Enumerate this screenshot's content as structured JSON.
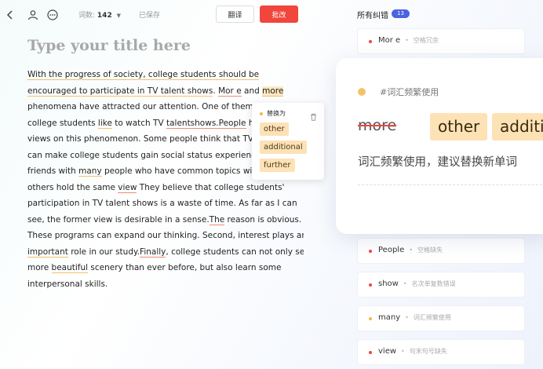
{
  "topbar": {
    "word_count_label": "词数:",
    "word_count_value": "142",
    "saved_status": "已保存",
    "translate_button": "翻译",
    "review_button": "批改"
  },
  "document": {
    "title_placeholder": "Type your title here",
    "lines": [
      [
        {
          "t": "With the progress of society, college students should be",
          "s": "y"
        }
      ],
      [
        {
          "t": "encouraged to participate in TV talent shows",
          "s": "y"
        },
        {
          "t": ". ",
          "s": ""
        },
        {
          "t": "Mor e",
          "s": "r"
        },
        {
          "t": " and ",
          "s": ""
        },
        {
          "t": "more",
          "s": "hl"
        }
      ],
      [
        {
          "t": "phenomena have attracted our attention. One of them is",
          "s": ""
        }
      ],
      [
        {
          "t": "college students ",
          "s": ""
        },
        {
          "t": "like",
          "s": "y"
        },
        {
          "t": " to watch TV ",
          "s": ""
        },
        {
          "t": "talentshows.People",
          "s": "r"
        },
        {
          "t": " hold different",
          "s": ""
        }
      ],
      [
        {
          "t": "views on this phenomenon. Some people think that TV talent shows",
          "s": ""
        }
      ],
      [
        {
          "t": "can make college students gain social status experience and make",
          "s": ""
        }
      ],
      [
        {
          "t": "friends with ",
          "s": ""
        },
        {
          "t": "many",
          "s": "y"
        },
        {
          "t": " people who have common topics with them. But",
          "s": ""
        }
      ],
      [
        {
          "t": "others hold the same ",
          "s": ""
        },
        {
          "t": "view",
          "s": "r"
        },
        {
          "t": " They believe that college students'",
          "s": ""
        }
      ],
      [
        {
          "t": "participation in TV talent shows is a waste of time. As far as I can",
          "s": ""
        }
      ],
      [
        {
          "t": "see, the former view is desirable in a sense.",
          "s": ""
        },
        {
          "t": "The",
          "s": "r"
        },
        {
          "t": " reason is obvious.",
          "s": ""
        }
      ],
      [
        {
          "t": "These programs can expand our thinking. Second, interest plays an",
          "s": ""
        }
      ],
      [
        {
          "t": "important",
          "s": "y"
        },
        {
          "t": " role in our study.",
          "s": ""
        },
        {
          "t": "Finally",
          "s": "r"
        },
        {
          "t": ", college students can not only see",
          "s": ""
        }
      ],
      [
        {
          "t": "more ",
          "s": ""
        },
        {
          "t": "beautiful",
          "s": "y"
        },
        {
          "t": " scenery than ever before, but also learn some",
          "s": ""
        }
      ],
      [
        {
          "t": "interpersonal skills.",
          "s": ""
        }
      ]
    ]
  },
  "popup": {
    "header": "替换为",
    "options": [
      "other",
      "additional",
      "further"
    ]
  },
  "panel": {
    "title": "所有纠错",
    "count": "13",
    "issues": [
      {
        "word": "Mor e",
        "desc": "空格冗余",
        "color": "#f0463c"
      },
      {
        "word": "People",
        "desc": "空格缺失",
        "color": "#f0463c"
      },
      {
        "word": "show",
        "desc": "名次单复数错误",
        "color": "#f0463c"
      },
      {
        "word": "many",
        "desc": "词汇频繁使用",
        "color": "#f3b74c"
      },
      {
        "word": "view",
        "desc": "句末句号缺失",
        "color": "#f0463c"
      }
    ]
  },
  "detail_card": {
    "tag": "#词汇频繁使用",
    "wrong_word": "more",
    "suggestions": [
      "other",
      "additi"
    ],
    "description": "词汇频繁使用，建议替换新单词"
  }
}
